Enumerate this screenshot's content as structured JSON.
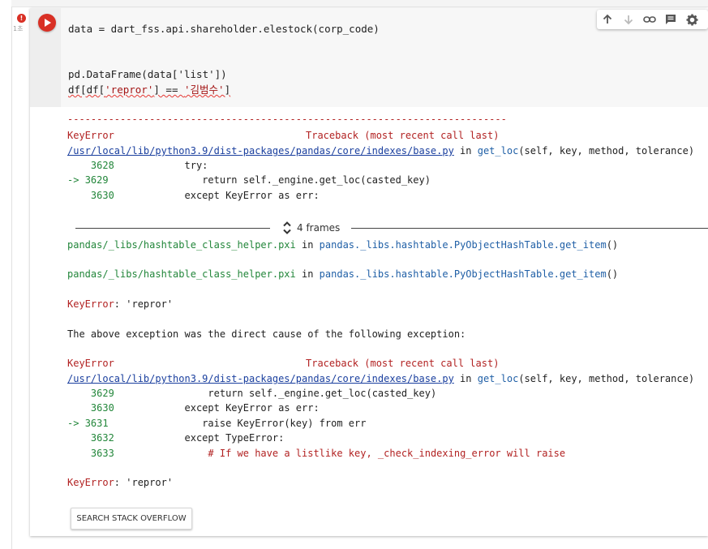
{
  "cell": {
    "error_badge": "!",
    "execution_count": "1초",
    "code_lines": {
      "line1": "data = dart_fss.api.shareholder.elestock(corp_code)",
      "line2": "pd.DataFrame(data['list'])",
      "line3_a": "df[df[",
      "line3_b": "'repror'",
      "line3_c": "] == ",
      "line3_d": "'김범수'",
      "line3_e": "]"
    }
  },
  "toolbar": {
    "icons": [
      "arrow-up-icon",
      "arrow-down-icon",
      "link-icon",
      "comment-icon",
      "gear-icon"
    ]
  },
  "output": {
    "dashes": "---------------------------------------------------------------------------",
    "tb1": {
      "error_name": "KeyError",
      "traceback_header": "Traceback (most recent call last)",
      "file_path": "/usr/local/lib/python3.9/dist-packages/pandas/core/indexes/base.py",
      "in_word": " in ",
      "func": "get_loc",
      "args": "(self, key, method, tolerance)",
      "lines": [
        {
          "prefix": "    ",
          "num": "3628",
          "code": "            try:"
        },
        {
          "prefix": "-> ",
          "num": "3629",
          "code": "                return self._engine.get_loc(casted_key)"
        },
        {
          "prefix": "    ",
          "num": "3630",
          "code": "            except KeyError as err:"
        }
      ]
    },
    "frames_label": "4 frames",
    "hash1": {
      "file": "pandas/_libs/hashtable_class_helper.pxi",
      "in_word": " in ",
      "func": "pandas._libs.hashtable.PyObjectHashTable.get_item",
      "tail": "()"
    },
    "hash2": {
      "file": "pandas/_libs/hashtable_class_helper.pxi",
      "in_word": " in ",
      "func": "pandas._libs.hashtable.PyObjectHashTable.get_item",
      "tail": "()"
    },
    "keyerror1": {
      "name": "KeyError",
      "msg": ": 'repror'"
    },
    "cause_text": "The above exception was the direct cause of the following exception:",
    "tb2": {
      "error_name": "KeyError",
      "traceback_header": "Traceback (most recent call last)",
      "file_path": "/usr/local/lib/python3.9/dist-packages/pandas/core/indexes/base.py",
      "in_word": " in ",
      "func": "get_loc",
      "args": "(self, key, method, tolerance)",
      "lines": [
        {
          "prefix": "    ",
          "num": "3629",
          "code": "                return self._engine.get_loc(casted_key)",
          "cls": "dark"
        },
        {
          "prefix": "    ",
          "num": "3630",
          "code": "            except KeyError as err:",
          "cls": "dark"
        },
        {
          "prefix": "-> ",
          "num": "3631",
          "code": "                raise KeyError(key) from err",
          "cls": "dark"
        },
        {
          "prefix": "    ",
          "num": "3632",
          "code": "            except TypeError:",
          "cls": "dark"
        },
        {
          "prefix": "    ",
          "num": "3633",
          "code": "                # If we have a listlike key, _check_indexing_error will raise",
          "cls": "red"
        }
      ]
    },
    "keyerror2": {
      "name": "KeyError",
      "msg": ": 'repror'"
    },
    "so_button": "SEARCH STACK OVERFLOW"
  },
  "colors": {
    "run_button": "#d93025",
    "error_red": "#b22222",
    "link_blue": "#1a3f9e",
    "path_green": "#22863a"
  }
}
